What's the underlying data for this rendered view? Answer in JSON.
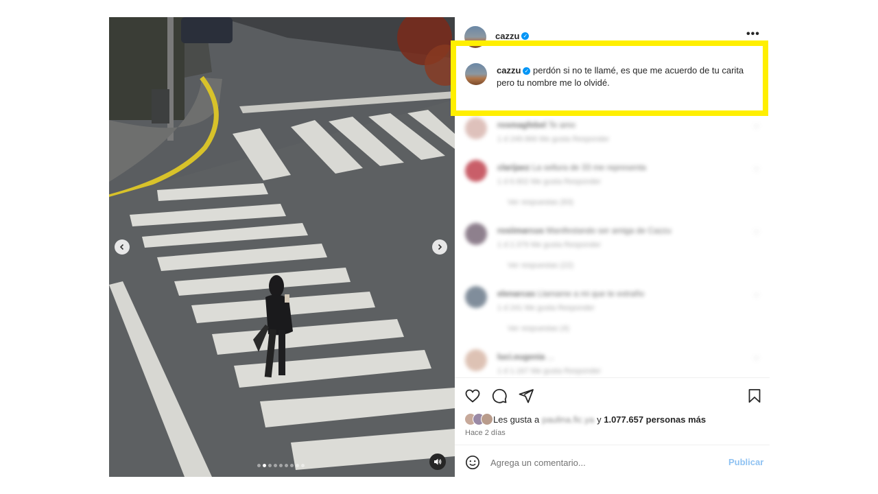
{
  "post": {
    "author": "cazzu",
    "verified": true
  },
  "caption": {
    "username": "cazzu",
    "text": "perdón si no te llamé, es que me acuerdo de tu carita pero tu nombre me lo olvidé."
  },
  "highlight_color": "#ffef00",
  "media": {
    "carousel_dots": 9,
    "active_dot": 1,
    "prev_icon": "chevron-left-icon",
    "next_icon": "chevron-right-icon",
    "audio_icon": "speaker-icon"
  },
  "comments": [
    {
      "user": "rosmagfebel",
      "text": "Te amo",
      "time": "1 d",
      "likes": "249.966 Me gusta",
      "reply": "Responder"
    },
    {
      "user": "clarijaez",
      "text": "La sellura de 33 me representa",
      "time": "1 d",
      "likes": "6.902 Me gusta",
      "reply": "Responder",
      "replies": "Ver respuestas (83)"
    },
    {
      "user": "rosiimarcus",
      "text": "Manifestando ser amiga de Cazzu",
      "time": "1 d",
      "likes": "2.379 Me gusta",
      "reply": "Responder",
      "replies": "Ver respuestas (22)"
    },
    {
      "user": "elenarcas",
      "text": "Llamame a mi que te extraño",
      "time": "1 d",
      "likes": "241 Me gusta",
      "reply": "Responder",
      "replies": "Ver respuestas (4)"
    },
    {
      "user": "luci.eugenia",
      "text": "...",
      "time": "1 d",
      "likes": "1.167 Me gusta",
      "reply": "Responder"
    }
  ],
  "actions": {
    "like_icon": "heart-icon",
    "comment_icon": "comment-icon",
    "share_icon": "send-icon",
    "save_icon": "bookmark-icon"
  },
  "likes": {
    "prefix": "Les gusta a",
    "blurred_user": "paulina.fic.ya",
    "connector": "y",
    "count_text": "1.077.657 personas más"
  },
  "date": "Hace 2 días",
  "composer": {
    "emoji_icon": "smiley-icon",
    "placeholder": "Agrega un comentario...",
    "publish_label": "Publicar"
  }
}
